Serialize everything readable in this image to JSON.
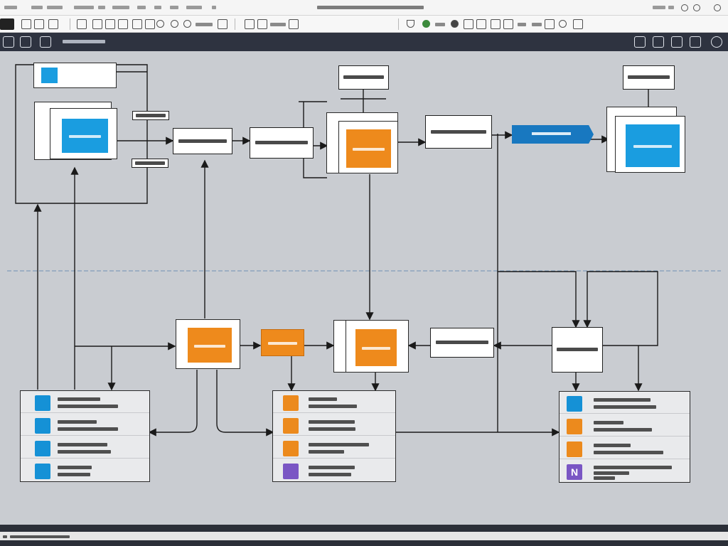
{
  "purple_tile_glyph": "N",
  "colors": {
    "blue": "#1a9de0",
    "orange": "#ee8a1c",
    "purple": "#7a56c4",
    "app_bar": "#2e3340",
    "canvas": "#c9ccd1"
  }
}
